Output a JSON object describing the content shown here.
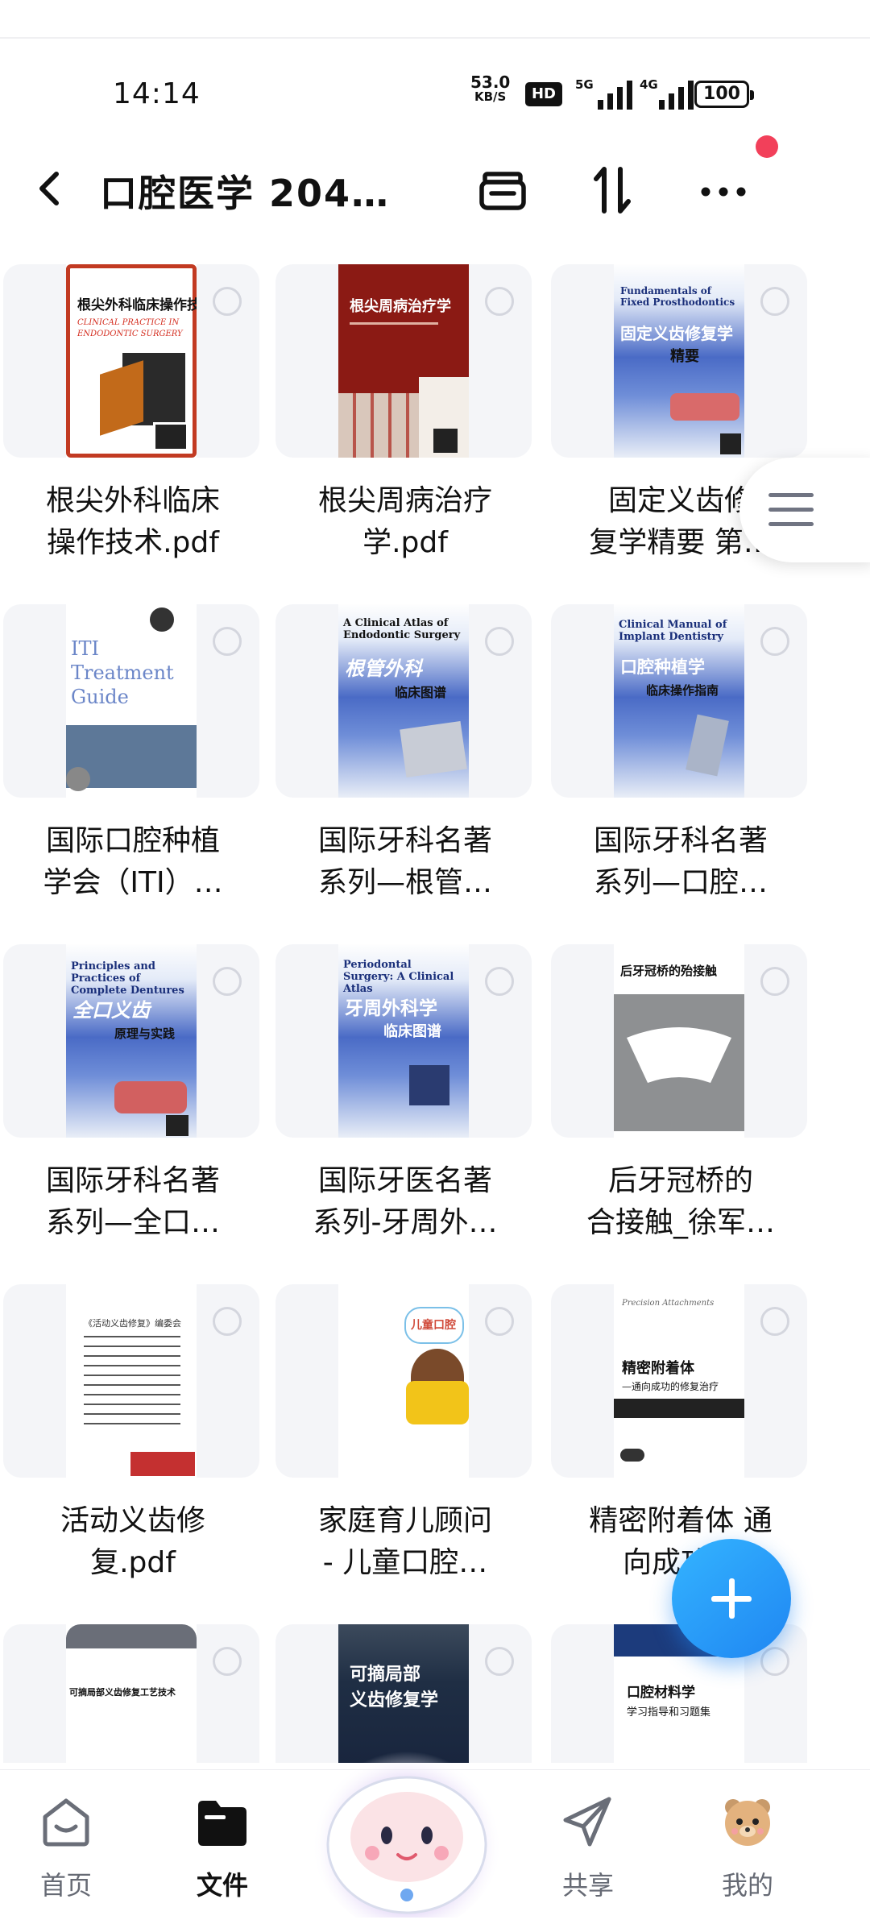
{
  "status_bar": {
    "time": "14:14",
    "net_speed": "53.0",
    "net_speed_unit": "KB/S",
    "hd_label": "HD",
    "sig1_label": "5G",
    "sig2_label": "4G",
    "battery": "100"
  },
  "header": {
    "title": "口腔医学 204…"
  },
  "files": [
    {
      "name": "根尖外科临床\n操作技术.pdf",
      "cover_title": "根尖外科临床操作技术",
      "cover_sub": "CLINICAL PRACTICE IN ENDODONTIC SURGERY"
    },
    {
      "name": "根尖周病治疗\n学.pdf",
      "cover_title": "根尖周病治疗学"
    },
    {
      "name": "固定义齿修\n复学精要 第…",
      "cover_title": "固定义齿修复学",
      "cover_title2": "精要",
      "cover_sub": "Fundamentals of Fixed Prosthodontics"
    },
    {
      "name": "国际口腔种植\n学会（ITI）…",
      "cover_title": "ITI Treatment Guide"
    },
    {
      "name": "国际牙科名著\n系列—根管…",
      "cover_title": "根管外科",
      "cover_title2": "临床图谱",
      "cover_sub": "A Clinical Atlas of Endodontic Surgery"
    },
    {
      "name": "国际牙科名著\n系列—口腔…",
      "cover_title": "口腔种植学",
      "cover_title2": "临床操作指南",
      "cover_sub": "Clinical Manual of Implant Dentistry"
    },
    {
      "name": "国际牙科名著\n系列—全口…",
      "cover_title": "全口义齿",
      "cover_title2": "原理与实践",
      "cover_sub": "Principles and Practices of Complete Dentures"
    },
    {
      "name": "国际牙医名著\n系列-牙周外…",
      "cover_title": "牙周外科学",
      "cover_title2": "临床图谱",
      "cover_sub": "Periodontal Surgery: A Clinical Atlas"
    },
    {
      "name": "后牙冠桥的\n合接触_徐军…",
      "cover_title": "后牙冠桥的殆接触"
    },
    {
      "name": "活动义齿修\n复.pdf",
      "cover_title": "《活动义齿修复》编委会"
    },
    {
      "name": "家庭育儿顾问\n- 儿童口腔…",
      "cover_title": "儿童口腔"
    },
    {
      "name": "精密附着体 通\n向成功…",
      "cover_title": "精密附着体",
      "cover_title2": "—通向成功的修复治疗",
      "cover_sub": "Precision Attachments"
    },
    {
      "name": "",
      "cover_title": "可摘局部义齿修复工艺技术"
    },
    {
      "name": "",
      "cover_title": "可摘局部",
      "cover_title2": "义齿修复学"
    },
    {
      "name": "",
      "cover_title": "口腔材料学",
      "cover_title2": "学习指导和习题集"
    }
  ],
  "bottom_nav": {
    "home": "首页",
    "files": "文件",
    "share": "共享",
    "mine": "我的"
  },
  "colors": {
    "accent": "#1f86f2",
    "notify_dot": "#f2405a",
    "active_nav": "#111111"
  }
}
